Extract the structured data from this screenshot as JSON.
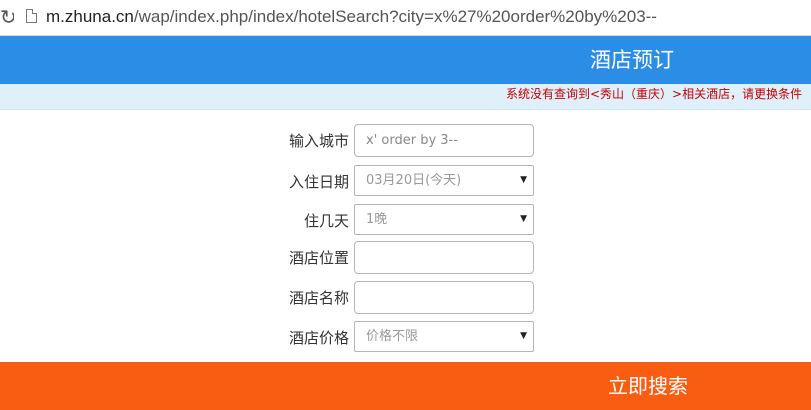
{
  "browser": {
    "url_host": "m.zhuna.cn",
    "url_rest": "/wap/index.php/index/hotelSearch?city=x%27%20order%20by%203--"
  },
  "header": {
    "title": "酒店预订",
    "notice": "系统没有查询到<秀山（重庆）>相关酒店，请更换条件"
  },
  "form": {
    "city_label": "输入城市",
    "city_value": "x' order by 3--",
    "checkin_label": "入住日期",
    "checkin_value": "03月20日(今天)",
    "nights_label": "住几天",
    "nights_value": "1晚",
    "location_label": "酒店位置",
    "location_value": "",
    "name_label": "酒店名称",
    "name_value": "",
    "price_label": "酒店价格",
    "price_value": "价格不限"
  },
  "search_button": "立即搜索",
  "colors": {
    "header": "#2b8de6",
    "notice_bg": "#dff0fb",
    "notice_text": "#c40000",
    "search_button": "#f95d12"
  }
}
